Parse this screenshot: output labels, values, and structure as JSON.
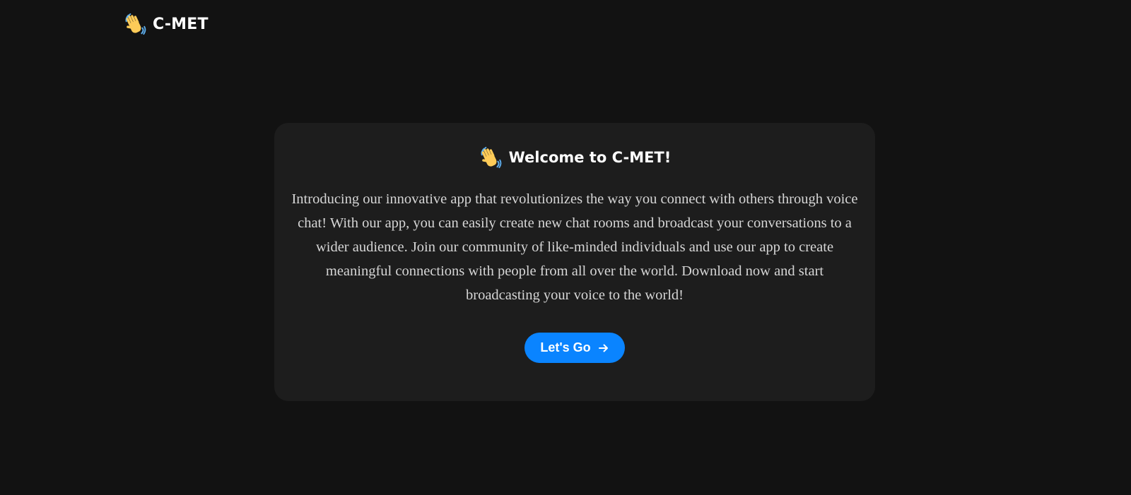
{
  "header": {
    "brand_name": "C-MET",
    "brand_icon": "waving-hand-icon"
  },
  "card": {
    "title": "Welcome to C-MET!",
    "title_icon": "waving-hand-icon",
    "description": "Introducing our innovative app that revolutionizes the way you connect with others through voice chat! With our app, you can easily create new chat rooms and broadcast your conversations to a wider audience. Join our community of like-minded individuals and use our app to create meaningful connections with people from all over the world. Download now and start broadcasting your voice to the world!",
    "button_label": "Let's Go",
    "button_icon": "arrow-right-icon"
  },
  "colors": {
    "background": "#121212",
    "card_background": "#1d1d1d",
    "accent": "#0a84ff",
    "text": "#ffffff",
    "muted_text": "#d6d6d6"
  }
}
